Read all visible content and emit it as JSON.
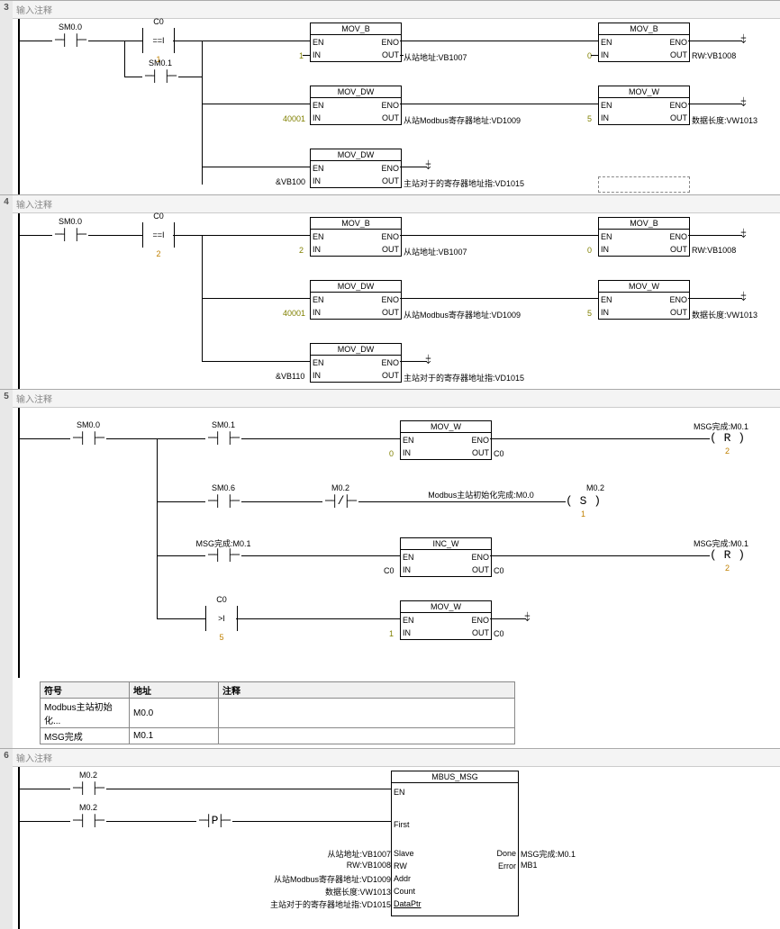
{
  "networks": {
    "n3": {
      "num": "3",
      "comment": "输入注释"
    },
    "n4": {
      "num": "4",
      "comment": "输入注释"
    },
    "n5": {
      "num": "5",
      "comment": "输入注释"
    },
    "n6": {
      "num": "6",
      "comment": "输入注释"
    }
  },
  "labels": {
    "sm00": "SM0.0",
    "sm01": "SM0.1",
    "sm06": "SM0.6",
    "c0": "C0",
    "m02": "M0.2",
    "msg_done": "MSG完成:M0.1",
    "modbus_init": "Modbus主站初始化完成:M0.0",
    "mov_b": "MOV_B",
    "mov_w": "MOV_W",
    "mov_dw": "MOV_DW",
    "inc_w": "INC_W",
    "mbus_msg": "MBUS_MSG",
    "en": "EN",
    "eno": "ENO",
    "in": "IN",
    "out": "OUT",
    "first": "First",
    "slave": "Slave",
    "rw": "RW",
    "addr": "Addr",
    "count": "Count",
    "dataptr": "DataPtr",
    "done": "Done",
    "error": "Error"
  },
  "values": {
    "one": "1",
    "two": "2",
    "five": "5",
    "zero": "0",
    "v40001": "40001",
    "vb100": "&VB100",
    "vb110": "&VB110",
    "slave_addr": "从站地址:VB1007",
    "rw_vb1008": "RW:VB1008",
    "modbus_reg": "从站Modbus寄存器地址:VD1009",
    "data_len": "数据长度:VW1013",
    "master_ptr": "主站对于的寄存器地址指:VD1015",
    "cmp_eq": "==I",
    "cmp_gt": ">I",
    "mb1": "MB1"
  },
  "symtable": {
    "headers": [
      "符号",
      "地址",
      "注释"
    ],
    "rows": [
      [
        "Modbus主站初始化...",
        "M0.0",
        ""
      ],
      [
        "MSG完成",
        "M0.1",
        ""
      ]
    ]
  }
}
